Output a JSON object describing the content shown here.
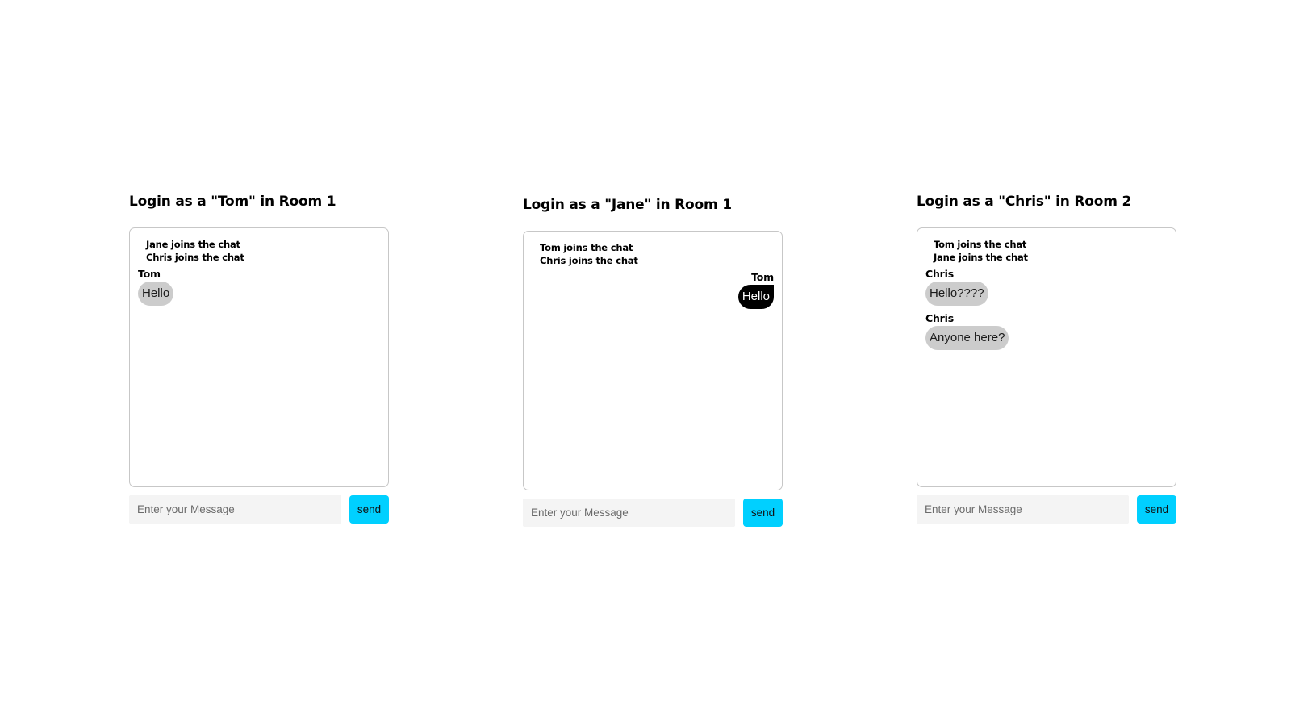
{
  "colors": {
    "send_button": "#00d0ff",
    "own_bubble": "#000000",
    "other_bubble": "#cccccc",
    "input_background": "#f4f4f4"
  },
  "panels": [
    {
      "title": "Login as a \"Tom\" in Room 1",
      "notices": [
        "Jane joins the chat",
        "Chris joins the chat"
      ],
      "messages": [
        {
          "sender": "Tom",
          "text": "Hello",
          "own": false
        }
      ],
      "input_placeholder": "Enter your Message",
      "send_label": "send"
    },
    {
      "title": "Login as a \"Jane\" in Room 1",
      "notices": [
        "Tom joins the chat",
        "Chris joins the chat"
      ],
      "messages": [
        {
          "sender": "Tom",
          "text": "Hello",
          "own": true
        }
      ],
      "input_placeholder": "Enter your Message",
      "send_label": "send"
    },
    {
      "title": "Login as a \"Chris\" in Room 2",
      "notices": [
        "Tom joins the chat",
        "Jane joins the chat"
      ],
      "messages": [
        {
          "sender": "Chris",
          "text": "Hello????",
          "own": false
        },
        {
          "sender": "Chris",
          "text": "Anyone here?",
          "own": false
        }
      ],
      "input_placeholder": "Enter your Message",
      "send_label": "send"
    }
  ]
}
